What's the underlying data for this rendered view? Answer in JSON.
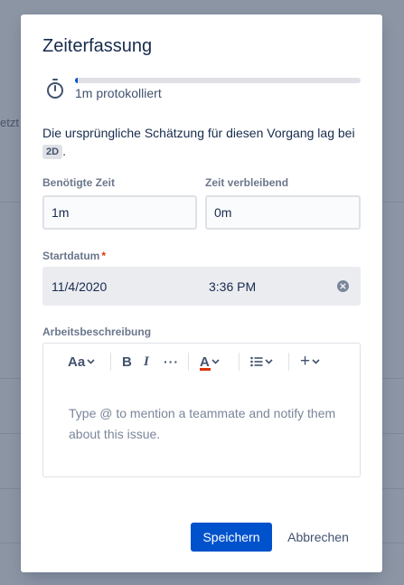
{
  "background": {
    "partial_text": "etzt"
  },
  "modal": {
    "title": "Zeiterfassung",
    "progress": {
      "fraction": 0.01,
      "logged_text": "1m protokolliert"
    },
    "estimate": {
      "text": "Die ursprüngliche Schätzung für diesen Vorgang lag bei",
      "value": "2D",
      "suffix": "."
    },
    "fields": {
      "time_needed": {
        "label": "Benötigte Zeit",
        "value": "1m"
      },
      "time_remaining": {
        "label": "Zeit verbleibend",
        "value": "0m"
      },
      "start_date": {
        "label": "Startdatum",
        "required_mark": "*",
        "date": "11/4/2020",
        "time": "3:36 PM"
      },
      "description": {
        "label": "Arbeitsbeschreibung",
        "placeholder": "Type @ to mention a teammate and notify them about this issue."
      }
    },
    "toolbar": {
      "text_style": "Aa",
      "bold": "B",
      "italic": "I",
      "more": "···",
      "color": "A",
      "insert": "+"
    },
    "buttons": {
      "save": "Speichern",
      "cancel": "Abbrechen"
    }
  },
  "colors": {
    "primary": "#0052cc",
    "required": "#de350b",
    "text_color_bar": "#de350b"
  }
}
